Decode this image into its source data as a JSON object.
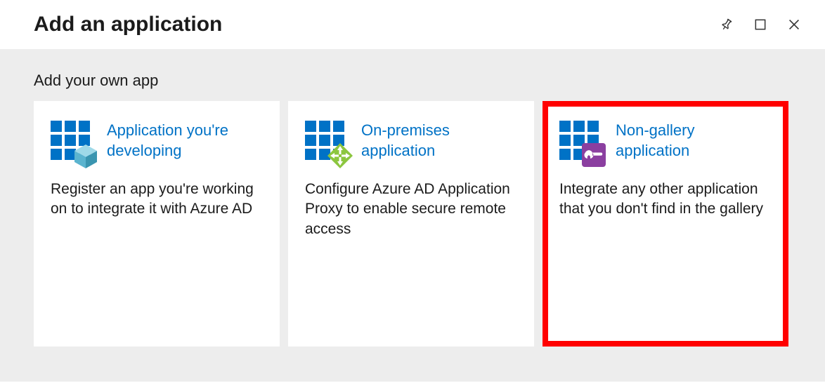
{
  "header": {
    "title": "Add an application"
  },
  "section": {
    "title": "Add your own app"
  },
  "cards": [
    {
      "title": "Application you're developing",
      "description": "Register an app you're working on to integrate it with Azure AD"
    },
    {
      "title": "On-premises application",
      "description": "Configure Azure AD Application Proxy to enable secure remote access"
    },
    {
      "title": "Non-gallery application",
      "description": "Integrate any other application that you don't find in the gallery"
    }
  ]
}
